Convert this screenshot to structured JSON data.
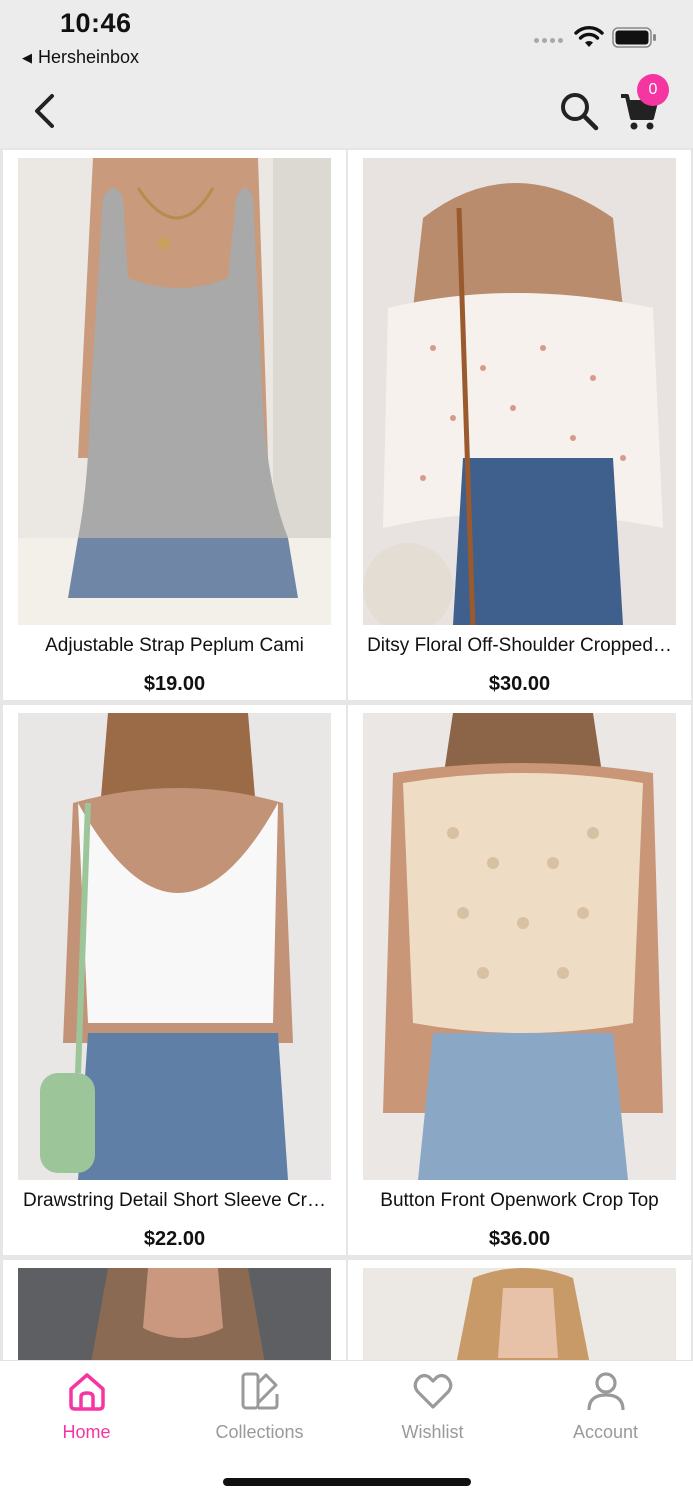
{
  "status_bar": {
    "time": "10:46",
    "back_app": "Hersheinbox",
    "back_glyph": "◀"
  },
  "nav": {
    "back_icon": "chevron-left-icon",
    "search_icon": "search-icon",
    "cart_icon": "cart-icon",
    "cart_count": "0"
  },
  "products": [
    {
      "title": "Adjustable Strap Peplum Cami",
      "price": "$19.00"
    },
    {
      "title": "Ditsy Floral Off-Shoulder Cropped…",
      "price": "$30.00"
    },
    {
      "title": "Drawstring Detail Short Sleeve Cr…",
      "price": "$22.00"
    },
    {
      "title": "Button Front Openwork Crop Top",
      "price": "$36.00"
    }
  ],
  "tabs": [
    {
      "label": "Home",
      "icon": "home-icon",
      "active": true
    },
    {
      "label": "Collections",
      "icon": "collections-icon",
      "active": false
    },
    {
      "label": "Wishlist",
      "icon": "heart-icon",
      "active": false
    },
    {
      "label": "Account",
      "icon": "user-icon",
      "active": false
    }
  ],
  "colors": {
    "accent": "#f535a2",
    "background": "#ececec",
    "tab_inactive": "#9a9a9a"
  }
}
